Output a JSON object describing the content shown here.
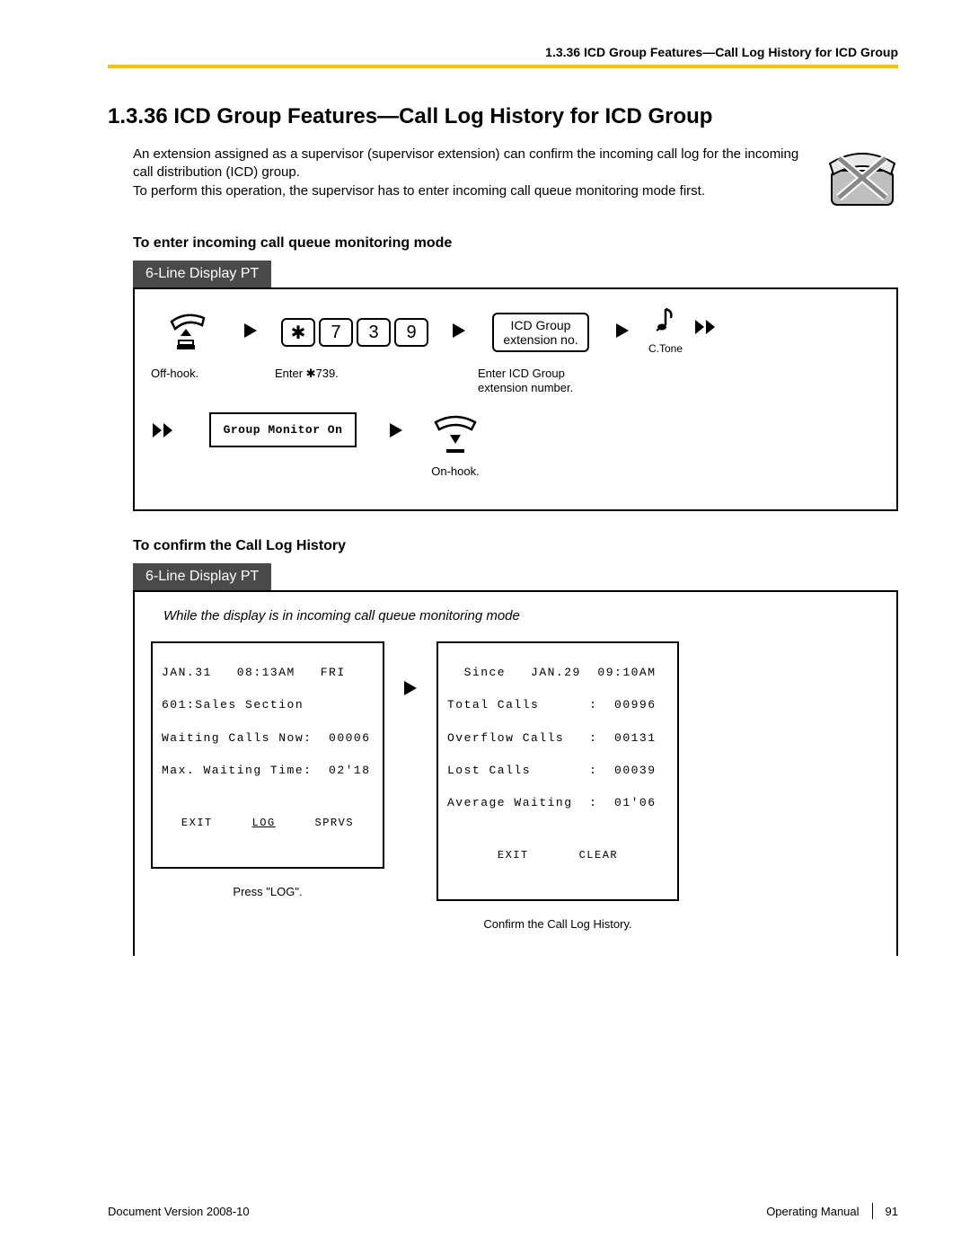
{
  "header": {
    "running_head": "1.3.36 ICD Group Features—Call Log History for ICD Group"
  },
  "title": "1.3.36  ICD Group Features—Call Log History for ICD Group",
  "intro": {
    "p1": "An extension assigned as a supervisor (supervisor extension) can confirm the incoming call log for the incoming call distribution (ICD) group.",
    "p2": "To perform this operation, the supervisor has to enter incoming call queue monitoring mode first."
  },
  "section1": {
    "heading": "To enter incoming call queue monitoring mode",
    "tab": "6-Line Display PT",
    "steps": {
      "offhook": "Off-hook.",
      "enter_code": "Enter ✱739.",
      "keys": [
        "✱",
        "7",
        "3",
        "9"
      ],
      "ext_box_line1": "ICD Group",
      "ext_box_line2": "extension no.",
      "enter_ext": "Enter ICD Group\nextension number.",
      "ctone": "C.Tone",
      "monitor_box": "Group Monitor On",
      "onhook": "On-hook."
    }
  },
  "section2": {
    "heading": "To confirm the Call Log History",
    "tab": "6-Line Display PT",
    "note": "While the display is in incoming call queue monitoring mode",
    "lcd1": {
      "line1": "JAN.31   08:13AM   FRI",
      "line2": "601:Sales Section",
      "line3": "Waiting Calls Now:  00006",
      "line4": "Max. Waiting Time:  02'18",
      "btn1": "EXIT",
      "btn2": "LOG",
      "btn3": "SPRVS",
      "caption": "Press \"LOG\"."
    },
    "lcd2": {
      "line1": "  Since   JAN.29  09:10AM",
      "line2": "Total Calls      :  00996",
      "line3": "Overflow Calls   :  00131",
      "line4": "Lost Calls       :  00039",
      "line5": "Average Waiting  :  01'06",
      "btn1": "EXIT",
      "btn2": "CLEAR",
      "caption": "Confirm the Call Log History."
    }
  },
  "footer": {
    "doc_version": "Document Version  2008-10",
    "manual": "Operating Manual",
    "page": "91"
  },
  "chart_data": {
    "type": "table",
    "title": "ICD Group Call Log History displays",
    "screens": [
      {
        "timestamp": "JAN.31 08:13AM FRI",
        "group": "601:Sales Section",
        "waiting_calls_now": 6,
        "max_waiting_time": "02'18",
        "softkeys": [
          "EXIT",
          "LOG",
          "SPRVS"
        ]
      },
      {
        "since": "JAN.29 09:10AM",
        "total_calls": 996,
        "overflow_calls": 131,
        "lost_calls": 39,
        "average_waiting": "01'06",
        "softkeys": [
          "EXIT",
          "CLEAR"
        ]
      }
    ]
  }
}
